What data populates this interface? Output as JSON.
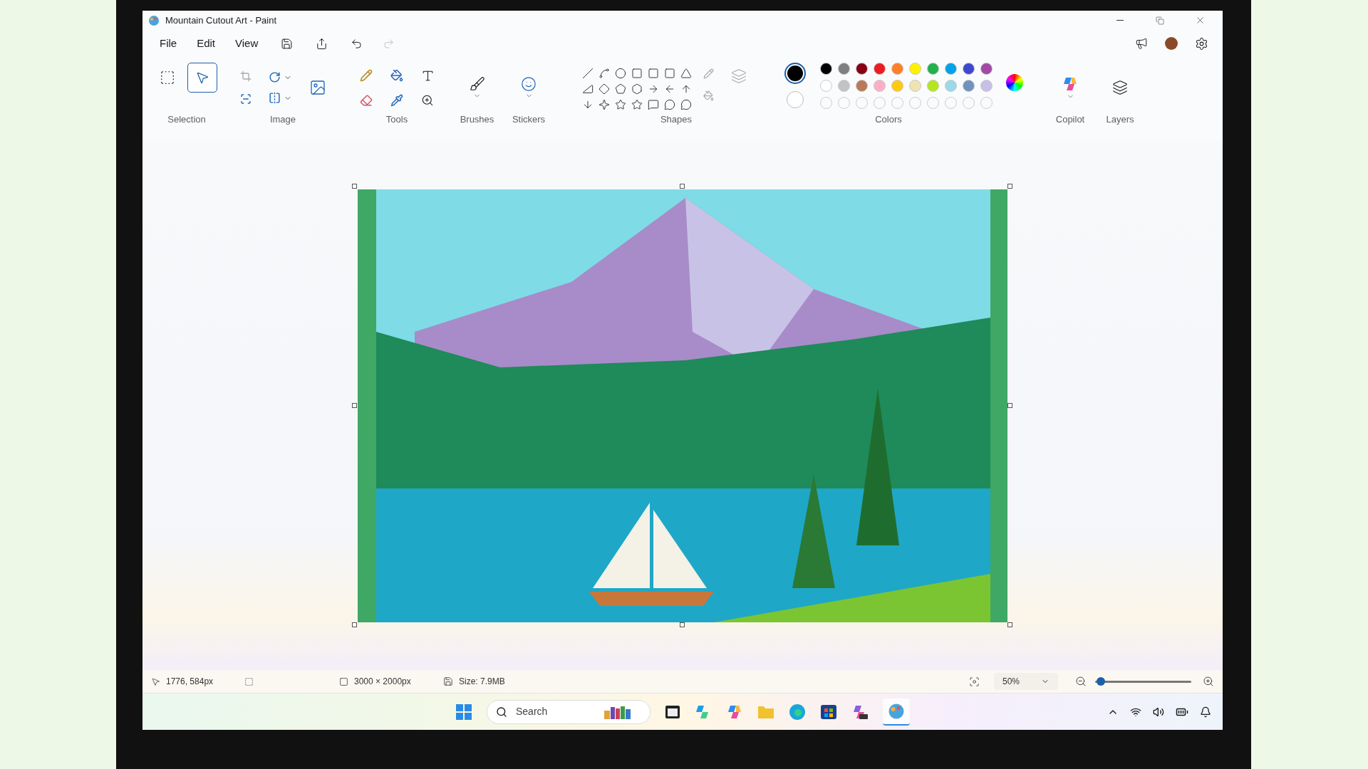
{
  "window": {
    "title": "Mountain Cutout Art - Paint"
  },
  "menu": [
    "File",
    "Edit",
    "View"
  ],
  "ribbon": {
    "selection": {
      "label": "Selection",
      "tools": [
        {
          "kind": "rectangle",
          "selected": false
        },
        {
          "kind": "freeform",
          "selected": true
        }
      ]
    },
    "image": {
      "label": "Image"
    },
    "tools": {
      "label": "Tools"
    },
    "brushes": {
      "label": "Brushes"
    },
    "stickers": {
      "label": "Stickers"
    },
    "shapes": {
      "label": "Shapes"
    },
    "colors": {
      "label": "Colors",
      "current": [
        {
          "kind": "primary",
          "color": "#000000"
        },
        {
          "kind": "secondary",
          "color": "#ffffff"
        }
      ],
      "palette": [
        {
          "swatches": [
            {
              "color": "#000000"
            },
            {
              "color": "#7f7f7f"
            },
            {
              "color": "#880015"
            },
            {
              "color": "#ed1c24"
            },
            {
              "color": "#ff7f27"
            },
            {
              "color": "#fff200"
            },
            {
              "color": "#22b14c"
            },
            {
              "color": "#00a2e8"
            },
            {
              "color": "#3f48cc"
            },
            {
              "color": "#a349a4"
            }
          ]
        },
        {
          "swatches": [
            {
              "color": "#ffffff"
            },
            {
              "color": "#c3c3c3"
            },
            {
              "color": "#b97a57"
            },
            {
              "color": "#ffaec9"
            },
            {
              "color": "#ffc90e"
            },
            {
              "color": "#efe4b0"
            },
            {
              "color": "#b5e61d"
            },
            {
              "color": "#99d9ea"
            },
            {
              "color": "#7092be"
            },
            {
              "color": "#c8bfe7"
            }
          ]
        }
      ]
    },
    "copilot": {
      "label": "Copilot"
    },
    "layers": {
      "label": "Layers"
    }
  },
  "status_bar": {
    "cursor": "1776, 584px",
    "canvas_size": "3000 × 2000px",
    "file_size": "Size: 7.9MB",
    "zoom": "50%",
    "zoom_slider": {
      "level": 0.06
    }
  },
  "taskbar": {
    "search": {
      "placeholder": "Search"
    }
  }
}
